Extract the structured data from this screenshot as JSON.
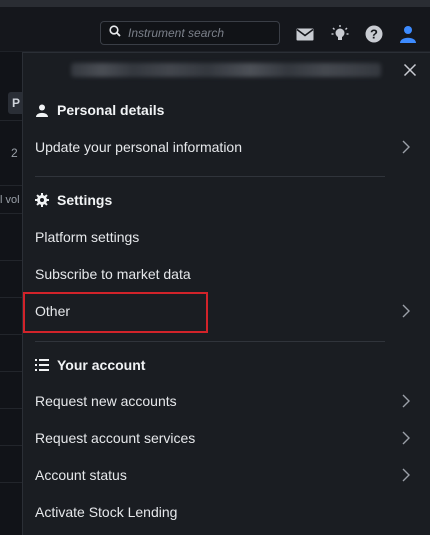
{
  "search": {
    "placeholder": "Instrument search"
  },
  "topbar_icons": [
    "search-icon",
    "mail-icon",
    "lightbulb-icon",
    "help-icon",
    "user-icon"
  ],
  "background_fragments": {
    "chip": "P",
    "number": "2",
    "column_header": "l vol"
  },
  "panel": {
    "sections": [
      {
        "title": "Personal details",
        "icon": "person-icon",
        "items": [
          {
            "label": "Update your personal information",
            "chevron": true
          }
        ]
      },
      {
        "title": "Settings",
        "icon": "gear-icon",
        "items": [
          {
            "label": "Platform settings",
            "chevron": false
          },
          {
            "label": "Subscribe to market data",
            "chevron": false
          },
          {
            "label": "Other",
            "chevron": true,
            "highlighted": true
          }
        ]
      },
      {
        "title": "Your account",
        "icon": "list-icon",
        "items": [
          {
            "label": "Request new accounts",
            "chevron": true
          },
          {
            "label": "Request account services",
            "chevron": true
          },
          {
            "label": "Account status",
            "chevron": true
          },
          {
            "label": "Activate Stock Lending",
            "chevron": false
          }
        ]
      }
    ]
  },
  "colors": {
    "panel_bg": "#1a1d22",
    "highlight_border": "#d2232a",
    "user_icon": "#3d8bff"
  }
}
